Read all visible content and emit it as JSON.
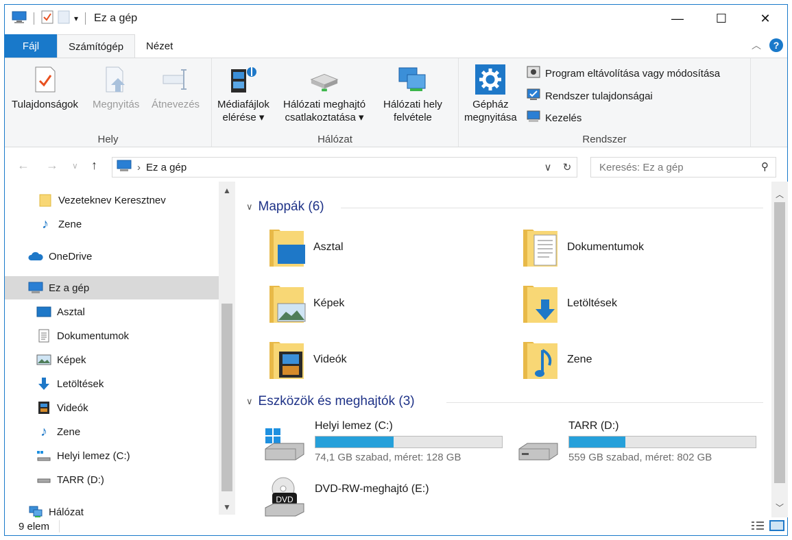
{
  "window": {
    "title": "Ez a gép",
    "controls": {
      "minimize": "—",
      "maximize": "☐",
      "close": "✕"
    }
  },
  "ribbon_tabs": [
    {
      "label": "Fájl"
    },
    {
      "label": "Számítógép"
    },
    {
      "label": "Nézet"
    }
  ],
  "ribbon": {
    "groups": {
      "hely": {
        "label": "Hely",
        "buttons": [
          "Tulajdonságok",
          "Megnyitás",
          "Átnevezés"
        ]
      },
      "halozat": {
        "label": "Hálózat",
        "buttons": [
          {
            "line1": "Médiafájlok",
            "line2": "elérése ▾"
          },
          {
            "line1": "Hálózati meghajtó",
            "line2": "csatlakoztatása ▾"
          },
          {
            "line1": "Hálózati hely",
            "line2": "felvétele"
          }
        ]
      },
      "rendszer": {
        "label": "Rendszer",
        "big_button": {
          "line1": "Gépház",
          "line2": "megnyitása"
        },
        "small_buttons": [
          "Program eltávolítása vagy módosítása",
          "Rendszer tulajdonságai",
          "Kezelés"
        ]
      }
    }
  },
  "navigation": {
    "path_item": "Ez a gép",
    "search_placeholder": "Keresés: Ez a gép"
  },
  "nav_pane": {
    "items": [
      {
        "label": "Vezeteknev Keresztnev",
        "icon": "folder-icon"
      },
      {
        "label": "Zene",
        "icon": "music-icon"
      },
      {
        "label": "OneDrive",
        "icon": "onedrive-icon"
      },
      {
        "label": "Ez a gép",
        "icon": "computer-icon"
      },
      {
        "label": "Asztal",
        "icon": "desktop-icon"
      },
      {
        "label": "Dokumentumok",
        "icon": "documents-icon"
      },
      {
        "label": "Képek",
        "icon": "pictures-icon"
      },
      {
        "label": "Letöltések",
        "icon": "downloads-icon"
      },
      {
        "label": "Videók",
        "icon": "videos-icon"
      },
      {
        "label": "Zene",
        "icon": "music-icon"
      },
      {
        "label": "Helyi lemez (C:)",
        "icon": "local-disk-icon"
      },
      {
        "label": "TARR (D:)",
        "icon": "drive-icon"
      },
      {
        "label": "Hálózat",
        "icon": "network-icon"
      }
    ]
  },
  "content": {
    "folders_header": "Mappák (6)",
    "folders": [
      "Asztal",
      "Dokumentumok",
      "Képek",
      "Letöltések",
      "Videók",
      "Zene"
    ],
    "drives_header": "Eszközök és meghajtók (3)",
    "drives": [
      {
        "name": "Helyi lemez (C:)",
        "subtitle": "74,1 GB szabad, méret: 128 GB",
        "used_fraction": 0.42
      },
      {
        "name": "TARR (D:)",
        "subtitle": "559 GB szabad, méret: 802 GB",
        "used_fraction": 0.3
      },
      {
        "name": "DVD-RW-meghajtó (E:)"
      }
    ]
  },
  "status": {
    "item_count": "9 elem"
  },
  "colors": {
    "accent": "#1979ca",
    "drive_bar": "#26a0da",
    "section_header": "#1e3287"
  }
}
